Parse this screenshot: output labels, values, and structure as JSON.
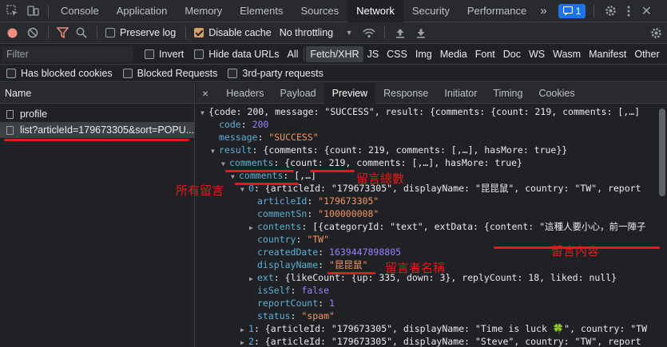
{
  "top_tabs": [
    "Console",
    "Application",
    "Memory",
    "Elements",
    "Sources",
    "Network",
    "Security",
    "Performance"
  ],
  "more_label": "»",
  "badge_count": "1",
  "toolbar1": {
    "preserve_log": "Preserve log",
    "disable_cache": "Disable cache",
    "throttling": "No throttling"
  },
  "toolbar2": {
    "filter_placeholder": "Filter",
    "invert": "Invert",
    "hide_data_urls": "Hide data URLs",
    "types": [
      "All",
      "Fetch/XHR",
      "JS",
      "CSS",
      "Img",
      "Media",
      "Font",
      "Doc",
      "WS",
      "Wasm",
      "Manifest",
      "Other"
    ]
  },
  "toolbar3": {
    "blocked_cookies": "Has blocked cookies",
    "blocked_requests": "Blocked Requests",
    "third_party": "3rd-party requests"
  },
  "name_header": "Name",
  "requests": [
    "profile",
    "list?articleId=179673305&sort=POPU..."
  ],
  "detail_close": "×",
  "detail_tabs": [
    "Headers",
    "Payload",
    "Preview",
    "Response",
    "Initiator",
    "Timing",
    "Cookies"
  ],
  "json": {
    "l0": "{code: 200, message: \"SUCCESS\", result: {comments: {count: 219, comments: [,…]",
    "code_key": "code",
    "code_val": "200",
    "message_key": "message",
    "message_val": "\"SUCCESS\"",
    "result_key": "result",
    "result_summary": "{comments: {count: 219, comments: [,…], hasMore: true}}",
    "comments_key": "comments",
    "comments_summary_a": "{count: 219",
    "comments_summary_b": ", comments: [,…], hasMore: true}",
    "comments_arr_key": "comments",
    "comments_arr_summary": "[,…]",
    "item0_key": "0",
    "item0_summary": "{articleId: \"179673305\", displayName: \"昆昆鼠\", country: \"TW\", report",
    "articleId_key": "articleId",
    "articleId_val": "\"179673305\"",
    "commentSn_key": "commentSn",
    "commentSn_val": "\"100000008\"",
    "contents_key": "contents",
    "contents_summary_a": "[{categoryId: \"text\", extData: ",
    "contents_summary_b": "{content: \"這種人要小心，前一陣子",
    "country_key": "country",
    "country_val": "\"TW\"",
    "createdDate_key": "createdDate",
    "createdDate_val": "1639447898805",
    "displayName_key": "displayName",
    "displayName_val": "\"昆昆鼠\"",
    "ext_key": "ext",
    "ext_summary": "{likeCount: {up: 335, down: 3}, replyCount: 18, liked: null}",
    "isSelf_key": "isSelf",
    "isSelf_val": "false",
    "reportCount_key": "reportCount",
    "reportCount_val": "1",
    "status_key": "status",
    "status_val": "\"spam\"",
    "item1_key": "1",
    "item1_summary": "{articleId: \"179673305\", displayName: \"Time is luck 🍀\", country: \"TW",
    "item2_key": "2",
    "item2_summary": "{articleId: \"179673305\", displayName: \"Steve\", country: \"TW\", report"
  },
  "annotations": {
    "total_comments": "留言總數",
    "all_comments": "所有留言",
    "comment_content": "留言內容",
    "commenter_name": "留言者名稱"
  },
  "colors": {
    "annotation": "#e01b1b",
    "record": "#f28b82",
    "checkbox_checked": "#d9a066",
    "badge": "#1a73e8"
  }
}
